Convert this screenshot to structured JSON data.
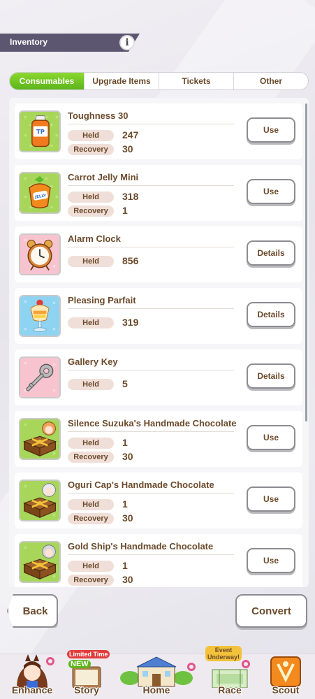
{
  "header": {
    "title": "Inventory",
    "info_glyph": "i"
  },
  "tabs": [
    {
      "label": "Consumables",
      "active": true
    },
    {
      "label": "Upgrade Items",
      "active": false
    },
    {
      "label": "Tickets",
      "active": false
    },
    {
      "label": "Other",
      "active": false
    }
  ],
  "items": [
    {
      "name": "Toughness 30",
      "icon": "tp-bottle-icon",
      "stats": [
        {
          "label": "Held",
          "value": "247"
        },
        {
          "label": "Recovery",
          "value": "30"
        }
      ],
      "button": "Use"
    },
    {
      "name": "Carrot Jelly Mini",
      "icon": "carrot-jelly-icon",
      "stats": [
        {
          "label": "Held",
          "value": "318"
        },
        {
          "label": "Recovery",
          "value": "1"
        }
      ],
      "button": "Use"
    },
    {
      "name": "Alarm Clock",
      "icon": "alarm-clock-icon",
      "stats": [
        {
          "label": "Held",
          "value": "856"
        }
      ],
      "button": "Details"
    },
    {
      "name": "Pleasing Parfait",
      "icon": "parfait-icon",
      "stats": [
        {
          "label": "Held",
          "value": "319"
        }
      ],
      "button": "Details"
    },
    {
      "name": "Gallery Key",
      "icon": "key-icon",
      "stats": [
        {
          "label": "Held",
          "value": "5"
        }
      ],
      "button": "Details"
    },
    {
      "name": "Silence Suzuka's Handmade Chocolate",
      "icon": "chocolate-box-icon",
      "stats": [
        {
          "label": "Held",
          "value": "1"
        },
        {
          "label": "Recovery",
          "value": "30"
        }
      ],
      "button": "Use"
    },
    {
      "name": "Oguri Cap's Handmade Chocolate",
      "icon": "chocolate-box-icon",
      "stats": [
        {
          "label": "Held",
          "value": "1"
        },
        {
          "label": "Recovery",
          "value": "30"
        }
      ],
      "button": "Use"
    },
    {
      "name": "Gold Ship's Handmade Chocolate",
      "icon": "chocolate-box-icon",
      "stats": [
        {
          "label": "Held",
          "value": "1"
        },
        {
          "label": "Recovery",
          "value": "30"
        }
      ],
      "button": "Use"
    }
  ],
  "footer": {
    "back_label": "Back",
    "convert_label": "Convert"
  },
  "nav": {
    "enhance": "Enhance",
    "story": "Story",
    "story_badge_top": "Limited Time",
    "story_badge_new": "NEW",
    "home": "Home",
    "race": "Race",
    "race_badge_1": "Event",
    "race_badge_2": "Underway!",
    "scout": "Scout"
  },
  "colors": {
    "active_tab": "#6cc322",
    "text_brown": "#6b4a2b",
    "header_bg": "#5c5670",
    "stat_label_bg": "#f0dfd8",
    "notify_pink": "#e2568a"
  }
}
